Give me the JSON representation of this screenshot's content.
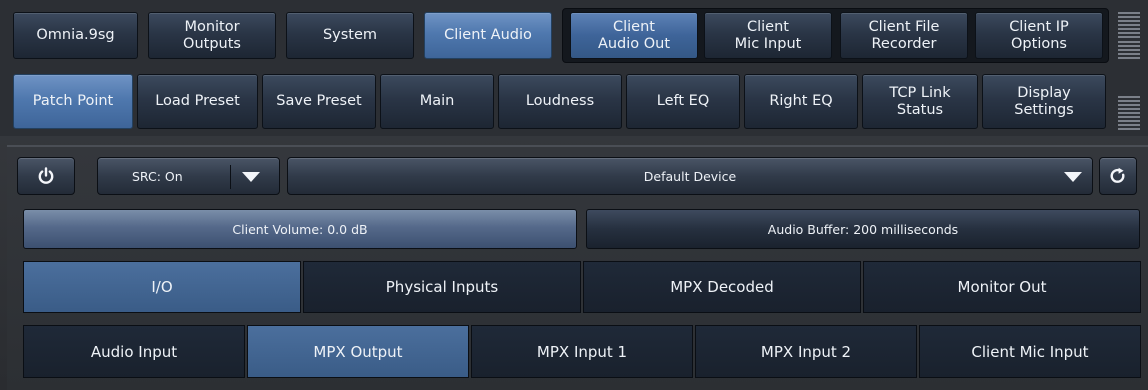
{
  "top_tabs": [
    {
      "label": "Omnia.9sg"
    },
    {
      "label": "Monitor\nOutputs"
    },
    {
      "label": "System"
    },
    {
      "label": "Client Audio"
    }
  ],
  "client_tabs": [
    {
      "label": "Client\nAudio Out"
    },
    {
      "label": "Client\nMic Input"
    },
    {
      "label": "Client File\nRecorder"
    },
    {
      "label": "Client IP\nOptions"
    }
  ],
  "sub_tabs": [
    {
      "label": "Patch Point"
    },
    {
      "label": "Load Preset"
    },
    {
      "label": "Save Preset"
    },
    {
      "label": "Main"
    },
    {
      "label": "Loudness"
    },
    {
      "label": "Left EQ"
    },
    {
      "label": "Right EQ"
    },
    {
      "label": "TCP Link\nStatus"
    },
    {
      "label": "Display\nSettings"
    }
  ],
  "controls": {
    "src_label": "SRC: On",
    "device_label": "Default Device",
    "volume_label": "Client Volume: 0.0 dB",
    "buffer_label": "Audio Buffer: 200 milliseconds"
  },
  "io_tabs": [
    "I/O",
    "Physical Inputs",
    "MPX Decoded",
    "Monitor Out"
  ],
  "source_tabs": [
    "Audio Input",
    "MPX Output",
    "MPX Input 1",
    "MPX Input 2",
    "Client Mic Input"
  ],
  "icons": {
    "power": "power-icon",
    "dropdown": "chevron-down-icon",
    "refresh": "refresh-icon"
  },
  "colors": {
    "active_blue": "#4f78ae",
    "dark_tab": "#1d2633"
  }
}
